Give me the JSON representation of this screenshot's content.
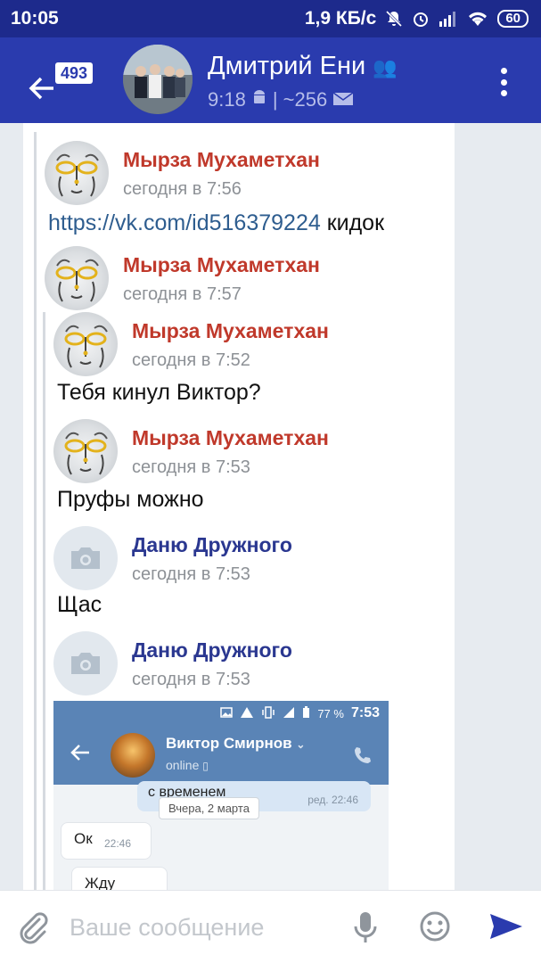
{
  "status_bar": {
    "time": "10:05",
    "speed": "1,9 КБ/с",
    "battery": "60"
  },
  "header": {
    "badge": "493",
    "title": "Дмитрий Ени",
    "subtitle_time": "9:18",
    "subtitle_count": "| ~256"
  },
  "messages": [
    {
      "author": "Мырза Мухаметхан",
      "time": "сегодня в 7:56",
      "text_link": "https://vk.com/id516379224",
      "text_after": " кидок"
    },
    {
      "author": "Мырза Мухаметхан",
      "time": "сегодня в 7:57"
    },
    {
      "author": "Мырза Мухаметхан",
      "time": "сегодня в 7:52",
      "text": "Тебя кинул Виктор?"
    },
    {
      "author": "Мырза Мухаметхан",
      "time": "сегодня в 7:53",
      "text": "Пруфы можно"
    },
    {
      "author": "Даню Дружного",
      "time": "сегодня в 7:53",
      "text": "Щас"
    },
    {
      "author": "Даню Дружного",
      "time": "сегодня в 7:53"
    }
  ],
  "screenshot": {
    "battery": "77 %",
    "time": "7:53",
    "contact_name": "Виктор Смирнов",
    "status": "online",
    "out_text": "с временем",
    "out_time": "ред. 22:46",
    "date_divider": "Вчера, 2 марта",
    "in1_text": "Ок",
    "in1_time": "22:46",
    "in2_text": "Жду"
  },
  "composer": {
    "placeholder": "Ваше сообщение"
  },
  "colors": {
    "status_bar": "#1d2a8c",
    "app_bar": "#2a3bae",
    "author_red": "#c0392b",
    "author_blue": "#2a3790",
    "link": "#2e5d8f"
  }
}
